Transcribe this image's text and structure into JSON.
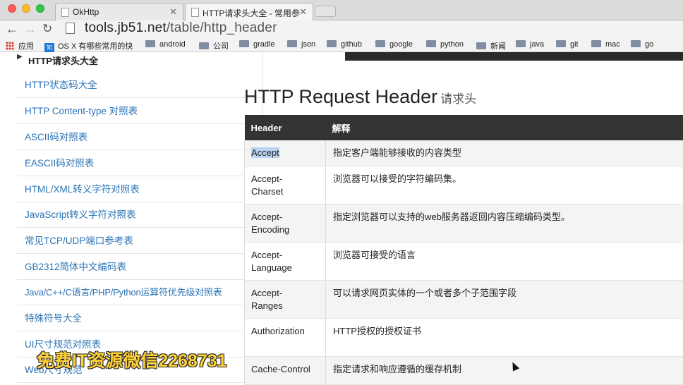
{
  "browser": {
    "tabs": [
      {
        "label": "OkHttp",
        "active": false
      },
      {
        "label": "HTTP请求头大全 - 常用参考",
        "active": true
      }
    ],
    "url_host": "tools.jb51.net",
    "url_path": "/table/http_header",
    "bookmarks": [
      {
        "label": "应用",
        "icon": "apps-grid-icon"
      },
      {
        "label": "OS X 有哪些常用的快",
        "icon": "zhihu-icon"
      },
      {
        "label": "android",
        "icon": "folder-icon"
      },
      {
        "label": "公司",
        "icon": "folder-icon"
      },
      {
        "label": "gradle",
        "icon": "folder-icon"
      },
      {
        "label": "json",
        "icon": "folder-icon"
      },
      {
        "label": "github",
        "icon": "folder-icon"
      },
      {
        "label": "google",
        "icon": "folder-icon"
      },
      {
        "label": "python",
        "icon": "folder-icon"
      },
      {
        "label": "新闻",
        "icon": "folder-icon"
      },
      {
        "label": "java",
        "icon": "folder-icon"
      },
      {
        "label": "git",
        "icon": "folder-icon"
      },
      {
        "label": "mac",
        "icon": "folder-icon"
      },
      {
        "label": "go",
        "icon": "folder-icon"
      }
    ]
  },
  "sidebar": {
    "title": "HTTP请求头大全",
    "items": [
      "HTTP状态码大全",
      "HTTP Content-type 对照表",
      "ASCII码对照表",
      "EASCII码对照表",
      "HTML/XML转义字符对照表",
      "JavaScript转义字符对照表",
      "常见TCP/UDP端口参考表",
      "GB2312简体中文编码表",
      "Java/C++/C语言/PHP/Python运算符优先级对照表",
      "特殊符号大全",
      "UI尺寸规范对照表",
      "Web尺寸规范"
    ]
  },
  "main": {
    "heading": "HTTP Request Header",
    "heading_sub": "请求头",
    "table": {
      "columns": [
        "Header",
        "解释"
      ],
      "rows": [
        {
          "header": "Accept",
          "desc": "指定客户端能够接收的内容类型"
        },
        {
          "header": "Accept-Charset",
          "desc": "浏览器可以接受的字符编码集。"
        },
        {
          "header": "Accept-Encoding",
          "desc": "指定浏览器可以支持的web服务器返回内容压缩编码类型。"
        },
        {
          "header": "Accept-Language",
          "desc": "浏览器可接受的语言"
        },
        {
          "header": "Accept-Ranges",
          "desc": "可以请求网页实体的一个或者多个子范围字段"
        },
        {
          "header": "Authorization",
          "desc": "HTTP授权的授权证书"
        },
        {
          "header": "Cache-Control",
          "desc": "指定请求和响应遵循的缓存机制"
        }
      ]
    }
  },
  "watermark": "免费IT资源微信2268731"
}
